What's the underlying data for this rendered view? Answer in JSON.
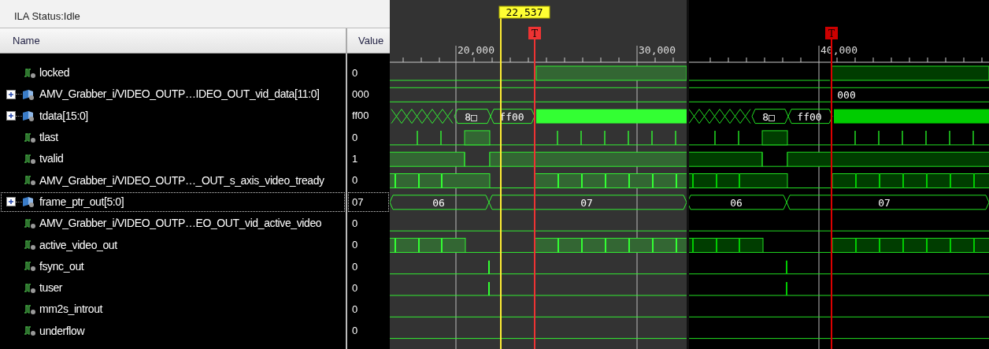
{
  "status": "ILA Status:Idle",
  "columns": {
    "name": "Name",
    "value": "Value"
  },
  "signals": [
    {
      "name": "locked",
      "kind": "step_up",
      "value": "0",
      "selected": false
    },
    {
      "name": "AMV_Grabber_i/VIDEO_OUTP…IDEO_OUT_vid_data[11:0]",
      "kind": "bus_flat",
      "value": "000",
      "selected": false
    },
    {
      "name": "tdata[15:0]",
      "kind": "bus_data",
      "value": "ff00",
      "selected": false
    },
    {
      "name": "tlast",
      "kind": "pulses",
      "value": "0",
      "selected": false
    },
    {
      "name": "tvalid",
      "kind": "valid",
      "value": "1",
      "selected": false
    },
    {
      "name": "AMV_Grabber_i/VIDEO_OUTP…_OUT_s_axis_video_tready",
      "kind": "ready",
      "value": "0",
      "selected": false
    },
    {
      "name": "frame_ptr_out[5:0]",
      "kind": "bus_ptr",
      "value": "07",
      "selected": true
    },
    {
      "name": "AMV_Grabber_i/VIDEO_OUTP…EO_OUT_vid_active_video",
      "kind": "low",
      "value": "0",
      "selected": false
    },
    {
      "name": "active_video_out",
      "kind": "active",
      "value": "0",
      "selected": false
    },
    {
      "name": "fsync_out",
      "kind": "spike",
      "value": "0",
      "selected": false
    },
    {
      "name": "tuser",
      "kind": "spike",
      "value": "0",
      "selected": false
    },
    {
      "name": "mm2s_introut",
      "kind": "low",
      "value": "0",
      "selected": false
    },
    {
      "name": "underflow",
      "kind": "low",
      "value": "0",
      "selected": false
    }
  ],
  "panels": [
    {
      "kind": "grey",
      "ticks": [
        "20,000",
        "30,000"
      ],
      "cursor": "22,537",
      "trigger": "T",
      "tdata": [
        "8□",
        "ff00"
      ],
      "frame_ptr": [
        "06",
        "07"
      ]
    },
    {
      "kind": "black",
      "ticks": [
        "40,000"
      ],
      "trigger": "T",
      "vid_data": "000",
      "tdata": [
        "8□",
        "ff00"
      ],
      "frame_ptr": [
        "06",
        "07"
      ]
    }
  ]
}
